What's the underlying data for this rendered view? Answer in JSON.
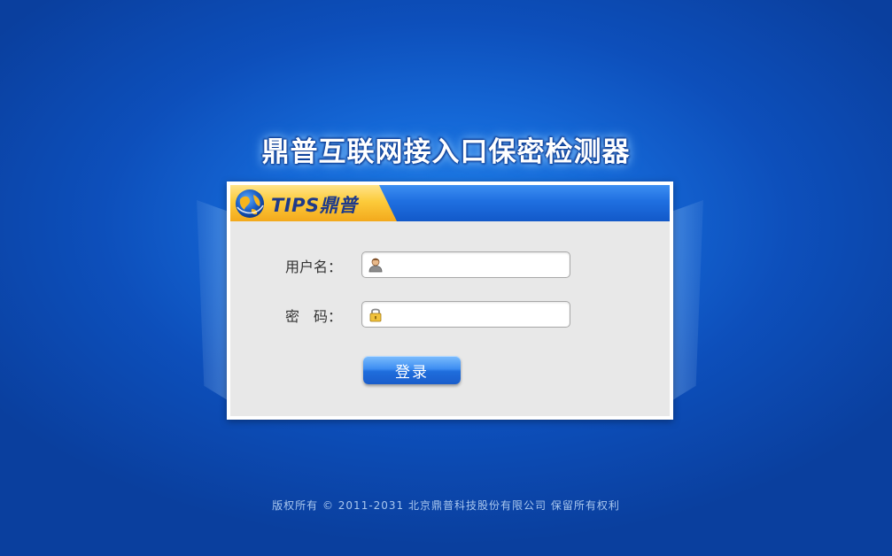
{
  "app": {
    "title": "鼎普互联网接入口保密检测器"
  },
  "brand": {
    "logo_text": "TIPS鼎普",
    "icon": "globe-logo-icon"
  },
  "form": {
    "username_label": "用户名：",
    "username_value": "",
    "username_icon": "user-icon",
    "password_label": "密　码：",
    "password_value": "",
    "password_icon": "lock-icon",
    "login_label": "登录"
  },
  "footer": {
    "copyright": "版权所有 © 2011-2031 北京鼎普科技股份有限公司 保留所有权利"
  },
  "colors": {
    "background": "#1568d7",
    "header_blue": "#1f6fe0",
    "logo_yellow": "#fccb3b",
    "panel_body": "#e8e8e8",
    "button_blue": "#3e8ef2"
  }
}
